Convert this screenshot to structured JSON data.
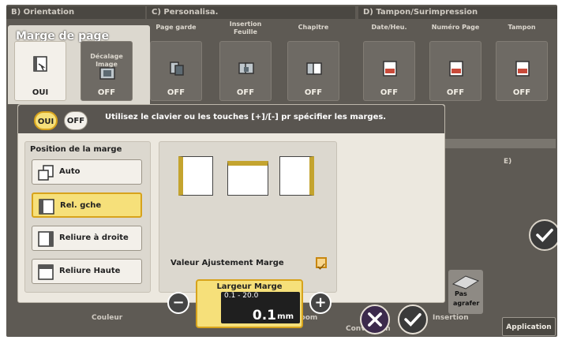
{
  "header_groups": [
    {
      "id": "b",
      "label": "B)  Orientation"
    },
    {
      "id": "c",
      "label": "C)  Personalisa."
    },
    {
      "id": "d",
      "label": "D)  Tampon/Surimpression"
    }
  ],
  "margin_tab": {
    "title": "Marge de page",
    "state": "OUI"
  },
  "tiles": [
    {
      "label": "Décalage\nImage",
      "state": "OFF"
    },
    {
      "label": "Page garde",
      "state": "OFF"
    },
    {
      "label": "Insertion\nFeuille",
      "state": "OFF"
    },
    {
      "label": "Chapitre",
      "state": "OFF"
    },
    {
      "label": "Date/Heu.",
      "state": "OFF"
    },
    {
      "label": "Numéro Page",
      "state": "OFF"
    },
    {
      "label": "Tampon",
      "state": "OFF"
    }
  ],
  "dialog": {
    "on_label": "OUI",
    "off_label": "OFF",
    "message": "Utilisez le clavier ou les touches [+]/[-] pr spécifier les marges.",
    "position_title": "Position de la marge",
    "positions": [
      {
        "label": "Auto"
      },
      {
        "label": "Rel. gche"
      },
      {
        "label": "Reliure à droite"
      },
      {
        "label": "Reliure Haute"
      }
    ],
    "adjust_label": "Valeur Ajustement Marge",
    "field": {
      "label": "Largeur Marge",
      "range": "0.1 - 20.0",
      "value": "0.1",
      "unit": "mm"
    },
    "minus": "−",
    "plus": "+"
  },
  "bottom": {
    "couleur": "Couleur",
    "zoom": "Zoom",
    "conversion": "Conversion",
    "insertion": "Insertion",
    "application": "Application"
  },
  "side_panel": {
    "line1": "Pas",
    "line2": "agrafer"
  },
  "right_letter": "E)",
  "colors": {
    "selected": "#f6e07a",
    "accent": "#d7a31c"
  }
}
